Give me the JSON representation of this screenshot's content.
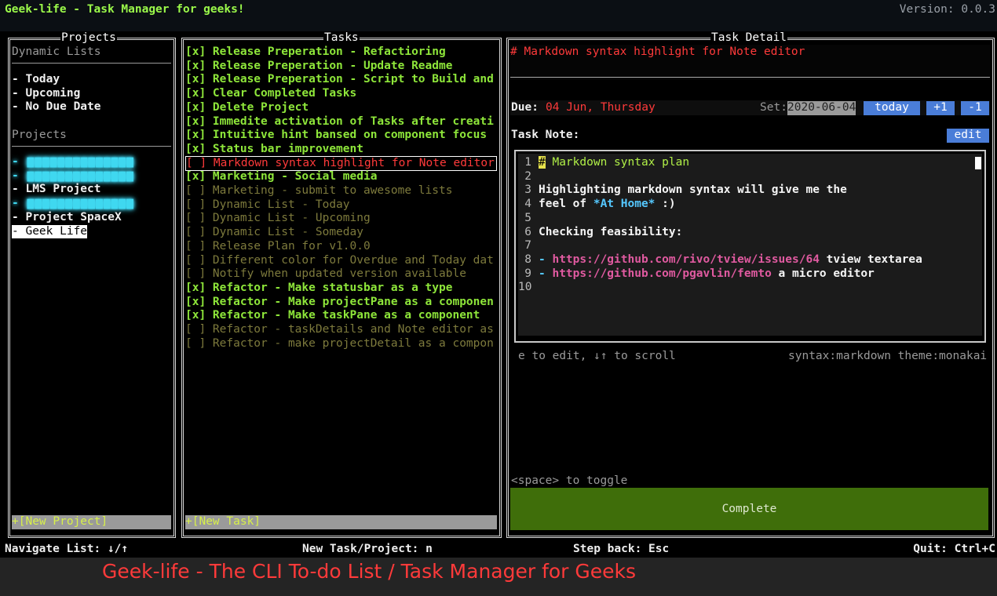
{
  "app": {
    "title": "Geek-life - Task Manager for geeks!",
    "version": "Version: 0.0.3"
  },
  "projects_panel": {
    "title": "Projects",
    "dynamic_header": "Dynamic Lists",
    "dynamic_items": [
      "- Today",
      "- Upcoming",
      "- No Due Date"
    ],
    "projects_header": "Projects",
    "projects": [
      "- ▆▆▆▆▆▆▆▆▆▆▆▆▆▆",
      "- ▆▆▆▆▆▆▆▆▆▆▆▆▆▆",
      "- LMS Project",
      "- ▆▆▆▆▆▆▆▆▆▆▆▆▆▆",
      "- Project SpaceX",
      "- Geek Life"
    ],
    "new_project": "+[New Project]"
  },
  "tasks_panel": {
    "title": "Tasks",
    "tasks": [
      "[x] Release Preperation - Refactioring",
      "[x] Release Preperation - Update Readme",
      "[x] Release Preperation - Script to Build and",
      "[x] Clear Completed Tasks",
      "[x] Delete Project",
      "[x] Immedite activation of Tasks after creati",
      "[x] Intuitive hint bansed on component focus",
      "[x] Status bar improvement",
      "[ ] Markdown syntax highlight for Note editor",
      "[x] Marketing - Social media",
      "[ ] Marketing - submit to awesome lists",
      "[ ] Dynamic List - Today",
      "[ ] Dynamic List - Upcoming",
      "[ ] Dynamic List - Someday",
      "[ ] Release Plan for v1.0.0",
      "[ ] Different color for Overdue and Today dat",
      "[ ] Notify when updated version available",
      "[x] Refactor - Make statusbar as a type",
      "[x] Refactor - Make projectPane as a componen",
      "[x] Refactor - Make taskPane as a component",
      "[ ] Refactor - taskDetails and Note editor as",
      "[ ] Refactor - make projectDetail as a compon"
    ],
    "new_task": "+[New Task]"
  },
  "detail_panel": {
    "title": "Task Detail",
    "task_title": "# Markdown syntax highlight for Note editor",
    "due_label": "Due:",
    "due_value": "04 Jun, Thursday",
    "set_label": "Set:",
    "date_input": "2020-06-04",
    "today_btn": "today",
    "plus_btn": "+1",
    "minus_btn": "-1",
    "note_label": "Task Note:",
    "edit_btn": "edit",
    "editor": {
      "line_numbers": [
        "1",
        "2",
        "3",
        "4",
        "5",
        "6",
        "7",
        "8",
        "9",
        "10"
      ],
      "l1_hash": "#",
      "l1_text": " Markdown syntax plan",
      "l3": "Highlighting markdown syntax will give me the",
      "l4_a": "feel of ",
      "l4_em": "*At Home*",
      "l4_b": " :)",
      "l6": "Checking feasibility:",
      "l8_dash": "- ",
      "l8_link": "https://github.com/rivo/tview/issues/64",
      "l8_text": " tview textarea",
      "l9_dash": "- ",
      "l9_link": "https://github.com/pgavlin/femto",
      "l9_text": " a micro editor"
    },
    "hint_left": "e to edit, ↓↑ to scroll",
    "hint_right": "syntax:markdown theme:monakai",
    "toggle_hint": "<space> to toggle",
    "complete_btn": "Complete"
  },
  "statusbar": {
    "navigate": "Navigate List: ↓/↑",
    "new": "New Task/Project: n",
    "back": "Step back: Esc",
    "quit": "Quit: Ctrl+C"
  },
  "banner": "Geek-life - The CLI To-do List / Task Manager for Geeks"
}
